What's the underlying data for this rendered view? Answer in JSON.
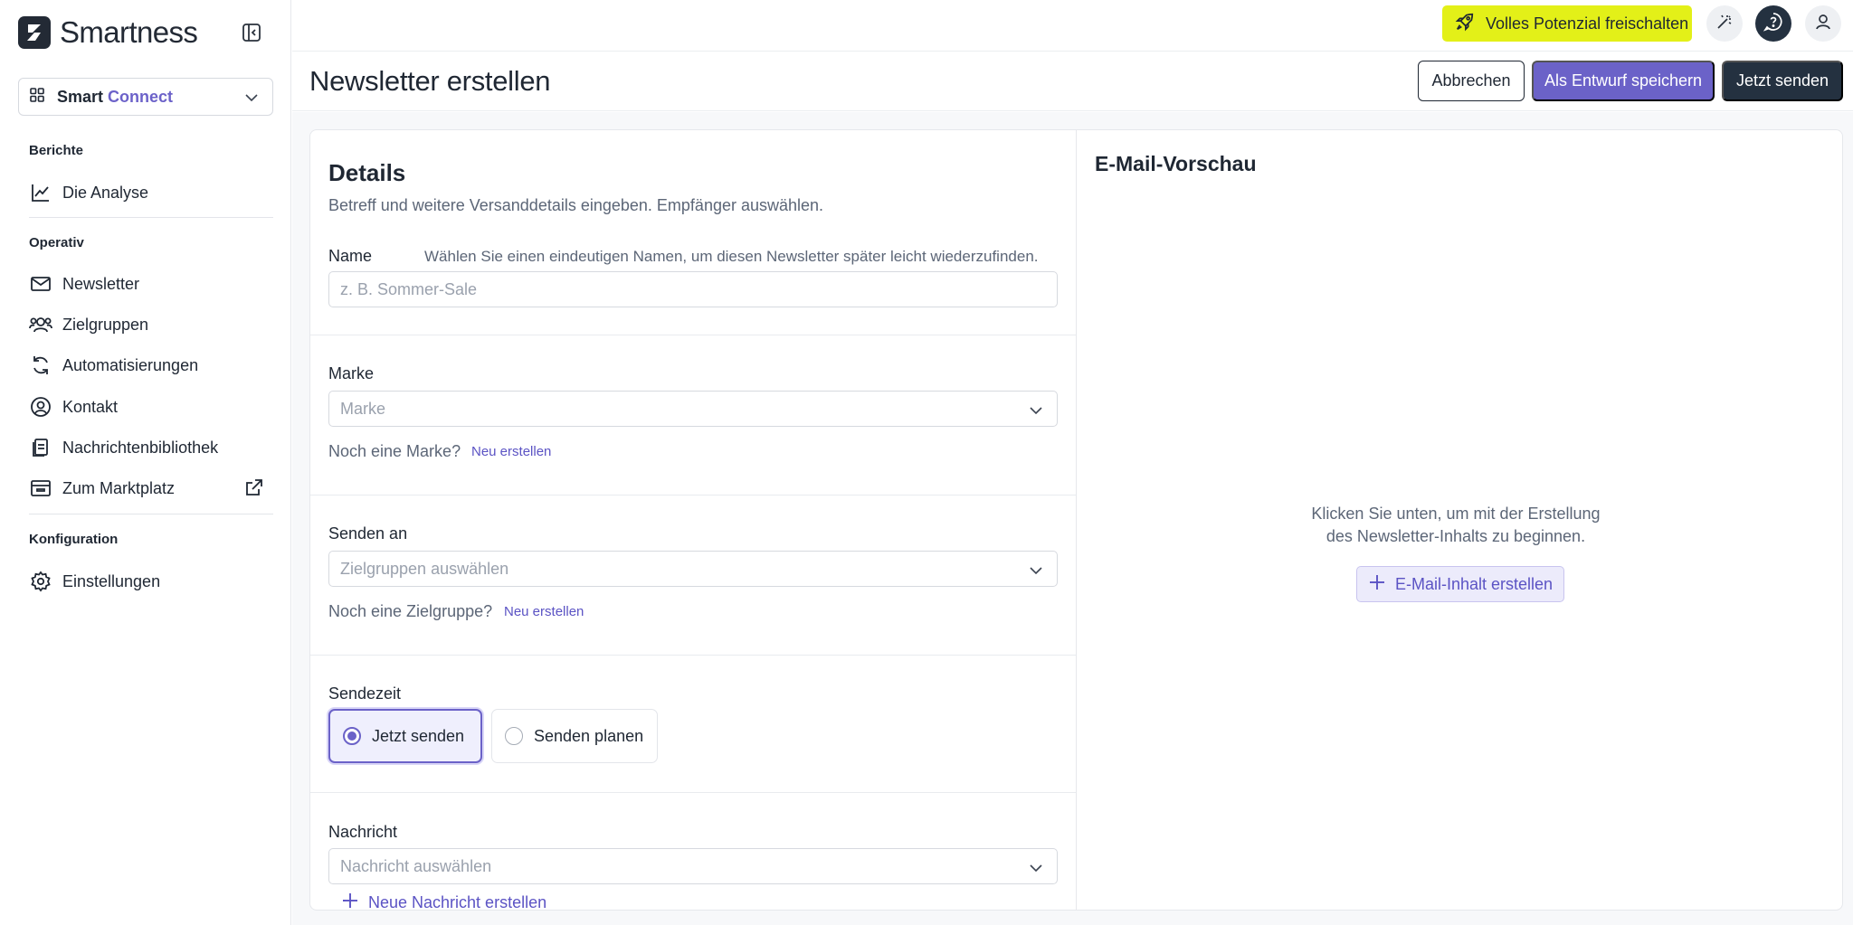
{
  "brand": {
    "name": "Smartness"
  },
  "workspace": {
    "label_main": "Smart",
    "label_accent": "Connect"
  },
  "sidebar": {
    "sections": [
      {
        "title": "Berichte"
      },
      {
        "title": "Operativ"
      },
      {
        "title": "Konfiguration"
      }
    ],
    "items": [
      {
        "label": "Die Analyse",
        "icon": "chart-line-icon"
      },
      {
        "label": "Newsletter",
        "icon": "mail-icon"
      },
      {
        "label": "Zielgruppen",
        "icon": "users-icon"
      },
      {
        "label": "Automatisierungen",
        "icon": "refresh-icon"
      },
      {
        "label": "Kontakt",
        "icon": "user-circle-icon"
      },
      {
        "label": "Nachrichtenbibliothek",
        "icon": "files-icon"
      },
      {
        "label": "Zum Marktplatz",
        "icon": "archive-icon",
        "trailing_icon": "external-link-icon"
      },
      {
        "label": "Einstellungen",
        "icon": "gear-icon"
      }
    ]
  },
  "topbar": {
    "upgrade_label": "Volles Potenzial freischalten",
    "icons": [
      "rocket-icon",
      "magic-wand-icon",
      "help-icon",
      "user-icon"
    ]
  },
  "header": {
    "title": "Newsletter erstellen",
    "cancel_label": "Abbrechen",
    "draft_label": "Als Entwurf speichern",
    "send_label": "Jetzt senden"
  },
  "details": {
    "title": "Details",
    "subtitle": "Betreff und weitere Versanddetails eingeben. Empfänger auswählen.",
    "name_label": "Name",
    "name_hint": "Wählen Sie einen eindeutigen Namen, um diesen Newsletter später leicht wiederzufinden.",
    "name_placeholder": "z. B. Sommer-Sale",
    "brand_label": "Marke",
    "brand_placeholder": "Marke",
    "brand_note": "Noch eine Marke?",
    "brand_link": "Neu erstellen",
    "recipients_label": "Senden an",
    "recipients_placeholder": "Zielgruppen auswählen",
    "recipients_note": "Noch eine Zielgruppe?",
    "recipients_link": "Neu erstellen",
    "sendtime_label": "Sendezeit",
    "sendtime_options": [
      "Jetzt senden",
      "Senden planen"
    ],
    "sendtime_selected": "Jetzt senden",
    "message_label": "Nachricht",
    "message_placeholder": "Nachricht auswählen",
    "new_message_label": "Neue Nachricht erstellen"
  },
  "preview": {
    "title": "E-Mail-Vorschau",
    "empty_line1": "Klicken Sie unten, um mit der Erstellung",
    "empty_line2": "des Newsletter-Inhalts zu beginnen.",
    "button_label": "E-Mail-Inhalt erstellen"
  },
  "colors": {
    "accent": "#6b62c8",
    "dark": "#243140",
    "highlight": "#e3f018"
  }
}
